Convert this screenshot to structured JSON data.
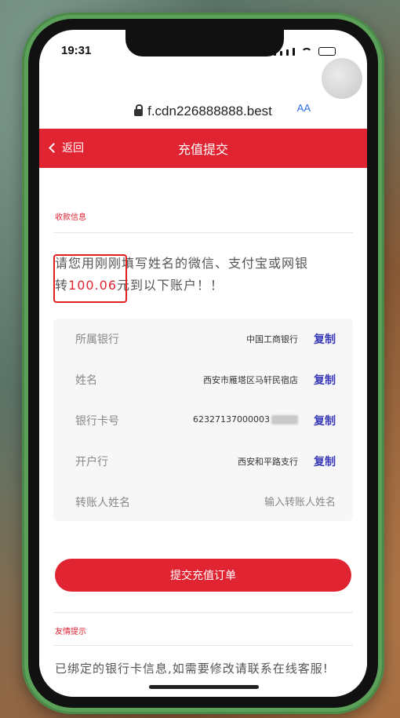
{
  "status_bar": {
    "time": "19:31"
  },
  "browser": {
    "url": "f.cdn226888888.best",
    "reader_label": "AA"
  },
  "nav": {
    "back_label": "返回",
    "title": "充值提交"
  },
  "payee_section": {
    "label": "收款信息"
  },
  "notice": {
    "line1": "请您用刚刚填写姓名的微信、支付宝或网银",
    "line2_prefix": "转",
    "amount": "100.06",
    "line2_suffix": "元到以下账户！！"
  },
  "info_rows": [
    {
      "label": "所属银行",
      "value": "中国工商银行",
      "action": "复制"
    },
    {
      "label": "姓名",
      "value": "西安市雁塔区马轩民宿店",
      "action": "复制"
    },
    {
      "label": "银行卡号",
      "value": "62327137000003",
      "action": "复制"
    },
    {
      "label": "开户行",
      "value": "西安和平路支行",
      "action": "复制"
    }
  ],
  "payer_row": {
    "label": "转账人姓名",
    "placeholder": "输入转账人姓名"
  },
  "submit": {
    "label": "提交充值订单"
  },
  "tips": {
    "label": "友情提示",
    "text": "已绑定的银行卡信息,如需要修改请联系在线客服!"
  },
  "colors": {
    "brand_red": "#e02432",
    "copy_link": "#3a3ab8",
    "phone_case": "#5ca15a"
  }
}
